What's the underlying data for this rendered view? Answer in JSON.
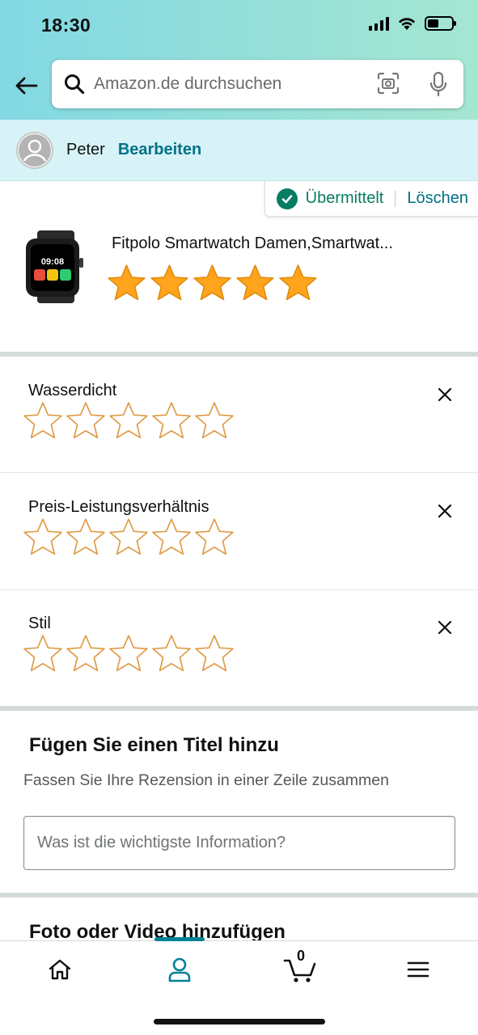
{
  "status_bar": {
    "time": "18:30"
  },
  "search": {
    "placeholder": "Amazon.de durchsuchen"
  },
  "profile": {
    "name": "Peter",
    "edit_label": "Bearbeiten"
  },
  "review_status": {
    "submitted_label": "Übermittelt",
    "delete_label": "Löschen"
  },
  "product": {
    "title": "Fitpolo Smartwatch Damen,Smartwat...",
    "watch_time": "09:08",
    "rating": 5,
    "max_rating": 5
  },
  "attributes": [
    {
      "label": "Wasserdicht",
      "rating": 0
    },
    {
      "label": "Preis-Leistungsverhältnis",
      "rating": 0
    },
    {
      "label": "Stil",
      "rating": 0
    }
  ],
  "title_section": {
    "heading": "Fügen Sie einen Titel hinzu",
    "subtitle": "Fassen Sie Ihre Rezension in einer Zeile zusammen",
    "placeholder": "Was ist die wichtigste Information?"
  },
  "media_section": {
    "heading": "Foto oder Video hinzufügen"
  },
  "bottom_nav": {
    "items": [
      "home-icon",
      "account-icon",
      "cart-icon",
      "menu-icon"
    ],
    "cart_count": "0",
    "active": "account-icon"
  },
  "colors": {
    "accent": "#007185",
    "success": "#067d62",
    "star_fill": "#ffa41c",
    "star_outline": "#de9b46"
  }
}
